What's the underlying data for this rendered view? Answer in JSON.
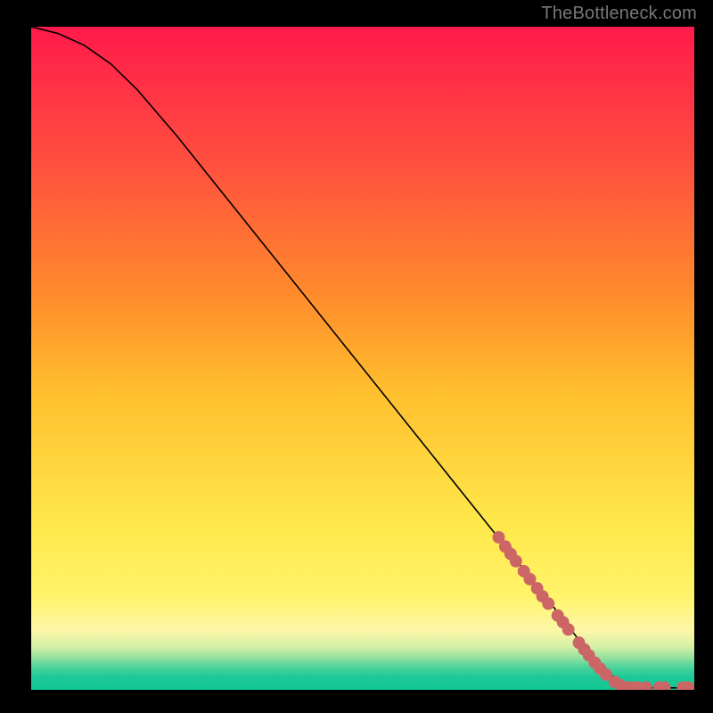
{
  "watermark": "TheBottleneck.com",
  "chart_data": {
    "type": "line",
    "title": "",
    "xlabel": "",
    "ylabel": "",
    "xlim": [
      0,
      100
    ],
    "ylim": [
      0,
      100
    ],
    "grid": false,
    "background_gradient": {
      "direction": "vertical",
      "stops": [
        {
          "offset": 0.0,
          "color": "#ff1a4b"
        },
        {
          "offset": 0.2,
          "color": "#ff4e3f"
        },
        {
          "offset": 0.4,
          "color": "#ff8a2b"
        },
        {
          "offset": 0.55,
          "color": "#ffbf2e"
        },
        {
          "offset": 0.75,
          "color": "#ffe84a"
        },
        {
          "offset": 0.86,
          "color": "#fff46b"
        },
        {
          "offset": 0.91,
          "color": "#fdf7a8"
        },
        {
          "offset": 0.935,
          "color": "#d6f0a6"
        },
        {
          "offset": 0.95,
          "color": "#9be3a0"
        },
        {
          "offset": 0.965,
          "color": "#4fd49b"
        },
        {
          "offset": 0.98,
          "color": "#1fc898"
        },
        {
          "offset": 1.0,
          "color": "#12c793"
        }
      ]
    },
    "series": [
      {
        "name": "curve",
        "color": "#000000",
        "width": 1.6,
        "points": [
          {
            "x": 0.0,
            "y": 100.0
          },
          {
            "x": 4.0,
            "y": 99.0
          },
          {
            "x": 8.0,
            "y": 97.2
          },
          {
            "x": 12.0,
            "y": 94.4
          },
          {
            "x": 16.0,
            "y": 90.5
          },
          {
            "x": 22.0,
            "y": 83.5
          },
          {
            "x": 30.0,
            "y": 73.5
          },
          {
            "x": 40.0,
            "y": 61.0
          },
          {
            "x": 50.0,
            "y": 48.5
          },
          {
            "x": 60.0,
            "y": 36.0
          },
          {
            "x": 70.0,
            "y": 23.5
          },
          {
            "x": 78.0,
            "y": 13.5
          },
          {
            "x": 83.0,
            "y": 7.0
          },
          {
            "x": 86.5,
            "y": 3.0
          },
          {
            "x": 89.0,
            "y": 1.0
          },
          {
            "x": 91.0,
            "y": 0.3
          },
          {
            "x": 95.0,
            "y": 0.3
          },
          {
            "x": 100.0,
            "y": 0.3
          }
        ]
      }
    ],
    "scatter": {
      "name": "markers",
      "color": "#cc6666",
      "radius": 7,
      "points": [
        {
          "x": 70.5,
          "y": 23.0
        },
        {
          "x": 71.5,
          "y": 21.6
        },
        {
          "x": 72.3,
          "y": 20.5
        },
        {
          "x": 73.1,
          "y": 19.4
        },
        {
          "x": 74.3,
          "y": 17.9
        },
        {
          "x": 75.2,
          "y": 16.7
        },
        {
          "x": 76.3,
          "y": 15.3
        },
        {
          "x": 77.1,
          "y": 14.1
        },
        {
          "x": 78.0,
          "y": 13.0
        },
        {
          "x": 79.4,
          "y": 11.2
        },
        {
          "x": 80.2,
          "y": 10.2
        },
        {
          "x": 81.0,
          "y": 9.1
        },
        {
          "x": 82.6,
          "y": 7.1
        },
        {
          "x": 83.4,
          "y": 6.1
        },
        {
          "x": 84.1,
          "y": 5.2
        },
        {
          "x": 85.0,
          "y": 4.1
        },
        {
          "x": 85.8,
          "y": 3.2
        },
        {
          "x": 86.7,
          "y": 2.3
        },
        {
          "x": 88.0,
          "y": 1.2
        },
        {
          "x": 88.8,
          "y": 0.7
        },
        {
          "x": 89.6,
          "y": 0.4
        },
        {
          "x": 90.5,
          "y": 0.35
        },
        {
          "x": 91.4,
          "y": 0.35
        },
        {
          "x": 92.7,
          "y": 0.35
        },
        {
          "x": 94.7,
          "y": 0.35
        },
        {
          "x": 95.5,
          "y": 0.35
        },
        {
          "x": 98.3,
          "y": 0.35
        },
        {
          "x": 99.1,
          "y": 0.35
        }
      ]
    }
  }
}
